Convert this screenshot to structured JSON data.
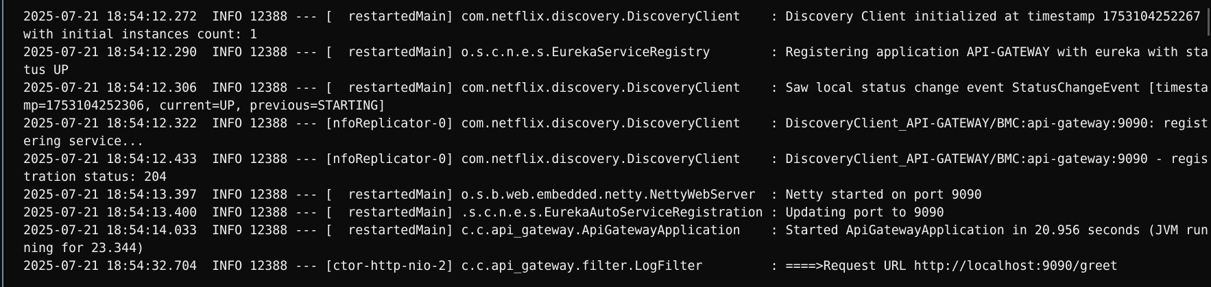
{
  "terminal": {
    "lines": [
      "2025-07-21 18:54:12.272  INFO 12388 --- [  restartedMain] com.netflix.discovery.DiscoveryClient    : Discovery Client initialized at timestamp 1753104252267 with initial instances count: 1",
      "2025-07-21 18:54:12.290  INFO 12388 --- [  restartedMain] o.s.c.n.e.s.EurekaServiceRegistry        : Registering application API-GATEWAY with eureka with status UP",
      "2025-07-21 18:54:12.306  INFO 12388 --- [  restartedMain] com.netflix.discovery.DiscoveryClient    : Saw local status change event StatusChangeEvent [timestamp=1753104252306, current=UP, previous=STARTING]",
      "2025-07-21 18:54:12.322  INFO 12388 --- [nfoReplicator-0] com.netflix.discovery.DiscoveryClient    : DiscoveryClient_API-GATEWAY/BMC:api-gateway:9090: registering service...",
      "2025-07-21 18:54:12.433  INFO 12388 --- [nfoReplicator-0] com.netflix.discovery.DiscoveryClient    : DiscoveryClient_API-GATEWAY/BMC:api-gateway:9090 - registration status: 204",
      "2025-07-21 18:54:13.397  INFO 12388 --- [  restartedMain] o.s.b.web.embedded.netty.NettyWebServer  : Netty started on port 9090",
      "2025-07-21 18:54:13.400  INFO 12388 --- [  restartedMain] .s.c.n.e.s.EurekaAutoServiceRegistration : Updating port to 9090",
      "2025-07-21 18:54:14.033  INFO 12388 --- [  restartedMain] c.c.api_gateway.ApiGatewayApplication    : Started ApiGatewayApplication in 20.956 seconds (JVM running for 23.344)",
      "2025-07-21 18:54:32.704  INFO 12388 --- [ctor-http-nio-2] c.c.api_gateway.filter.LogFilter         : ====>Request URL http://localhost:9090/greet"
    ]
  }
}
